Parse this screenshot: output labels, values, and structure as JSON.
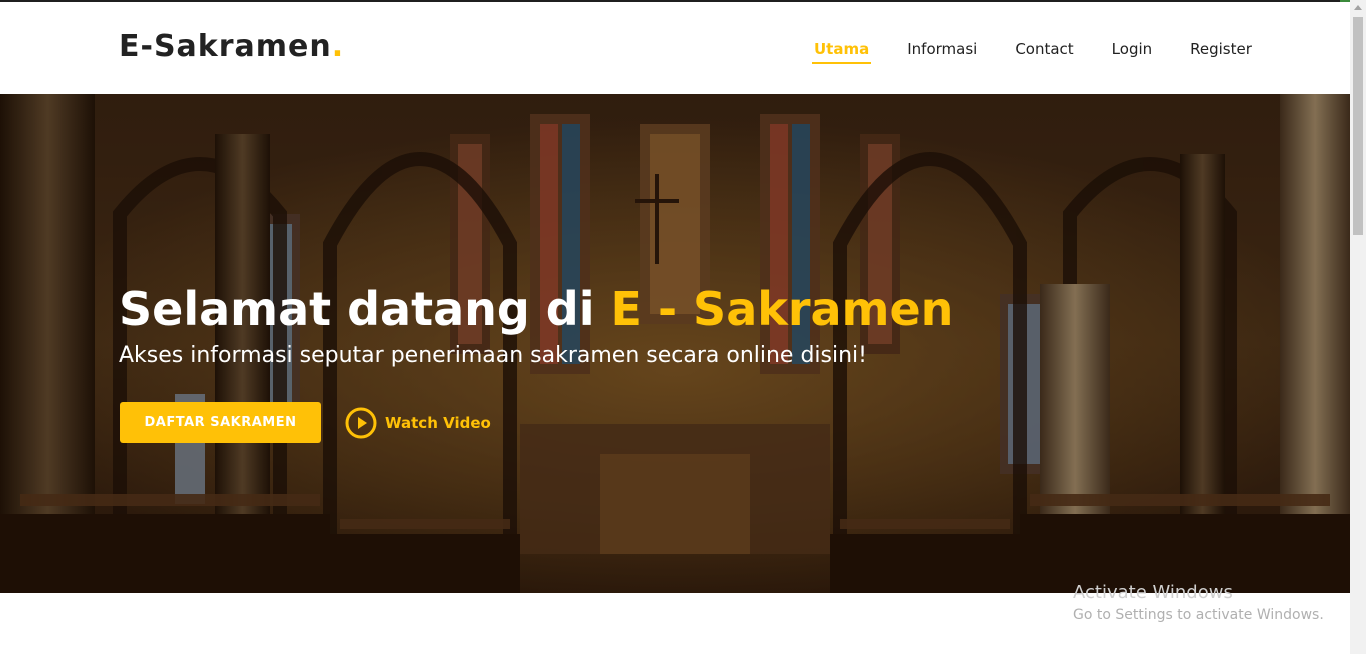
{
  "header": {
    "logo_text": "E-Sakramen",
    "logo_dot": "."
  },
  "nav": {
    "items": [
      {
        "label": "Utama",
        "active": true
      },
      {
        "label": "Informasi",
        "active": false
      },
      {
        "label": "Contact",
        "active": false
      },
      {
        "label": "Login",
        "active": false
      },
      {
        "label": "Register",
        "active": false
      }
    ]
  },
  "hero": {
    "title_prefix": "Selamat datang di ",
    "title_accent": "E - Sakramen",
    "subtitle": "Akses informasi seputar penerimaan sakramen secara online disini!",
    "cta_label": "DAFTAR SAKRAMEN",
    "video_label": "Watch Video",
    "play_icon": "play-circle-icon"
  },
  "watermark": {
    "title": "Activate Windows",
    "subtitle": "Go to Settings to activate Windows."
  },
  "colors": {
    "accent": "#ffc107",
    "text_dark": "#222222",
    "white": "#ffffff"
  }
}
